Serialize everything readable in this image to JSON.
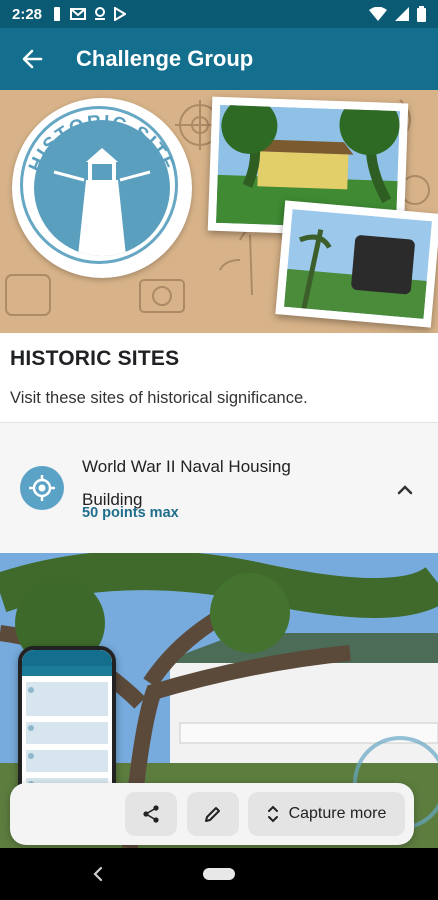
{
  "status": {
    "time": "2:28"
  },
  "appbar": {
    "title": "Challenge Group"
  },
  "hero": {
    "badge_text": "HISTORIC SITE"
  },
  "section": {
    "title": "HISTORIC SITES",
    "description": "Visit these sites of historical significance."
  },
  "challenge_item": {
    "name": "World War II Naval Housing Building",
    "points": "50 points max"
  },
  "bottom_bar": {
    "capture_label": "Capture more"
  },
  "colors": {
    "status_bar": "#0b5a73",
    "app_bar": "#136f8d",
    "accent": "#1f6e8c",
    "icon_circle": "#5ba3c6"
  }
}
